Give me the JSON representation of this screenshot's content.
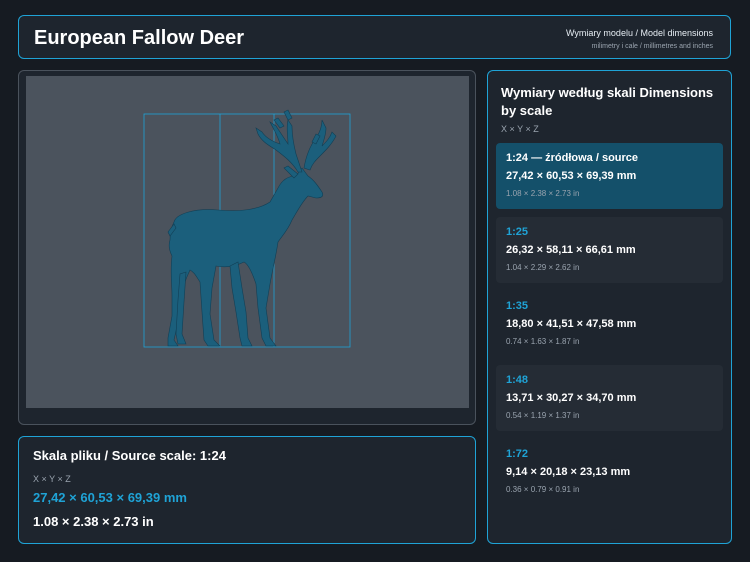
{
  "header": {
    "title": "European Fallow Deer",
    "subtitle": "Wymiary modelu / Model dimensions",
    "subtitle_units": "milimetry i cale / millimetres and inches"
  },
  "source": {
    "heading": "Skala pliku / Source scale: 1:24",
    "axes": "X × Y × Z",
    "mm": "27,42 × 60,53 × 69,39 mm",
    "inch": "1.08 × 2.38 × 2.73 in"
  },
  "scales": {
    "heading": "Wymiary według skali Dimensions by scale",
    "axes": "X × Y × Z",
    "items": [
      {
        "ratio": "1:24  —  źródłowa / source",
        "mm": "27,42 × 60,53 × 69,39 mm",
        "inch": "1.08 × 2.38 × 2.73 in"
      },
      {
        "ratio": "1:25",
        "mm": "26,32 × 58,11 × 66,61 mm",
        "inch": "1.04 × 2.29 × 2.62 in"
      },
      {
        "ratio": "1:35",
        "mm": "18,80 × 41,51 × 47,58 mm",
        "inch": "0.74 × 1.63 × 1.87 in"
      },
      {
        "ratio": "1:48",
        "mm": "13,71 × 30,27 × 34,70 mm",
        "inch": "0.54 × 1.19 × 1.37 in"
      },
      {
        "ratio": "1:72",
        "mm": "9,14 × 20,18 × 23,13 mm",
        "inch": "0.36 × 0.79 × 0.91 in"
      }
    ]
  },
  "colors": {
    "accent": "#1fa3d6",
    "model": "#1b5f7c",
    "background": "#161b22",
    "viewport": "#4b535d"
  },
  "icons": {
    "model": "deer-model-icon"
  }
}
